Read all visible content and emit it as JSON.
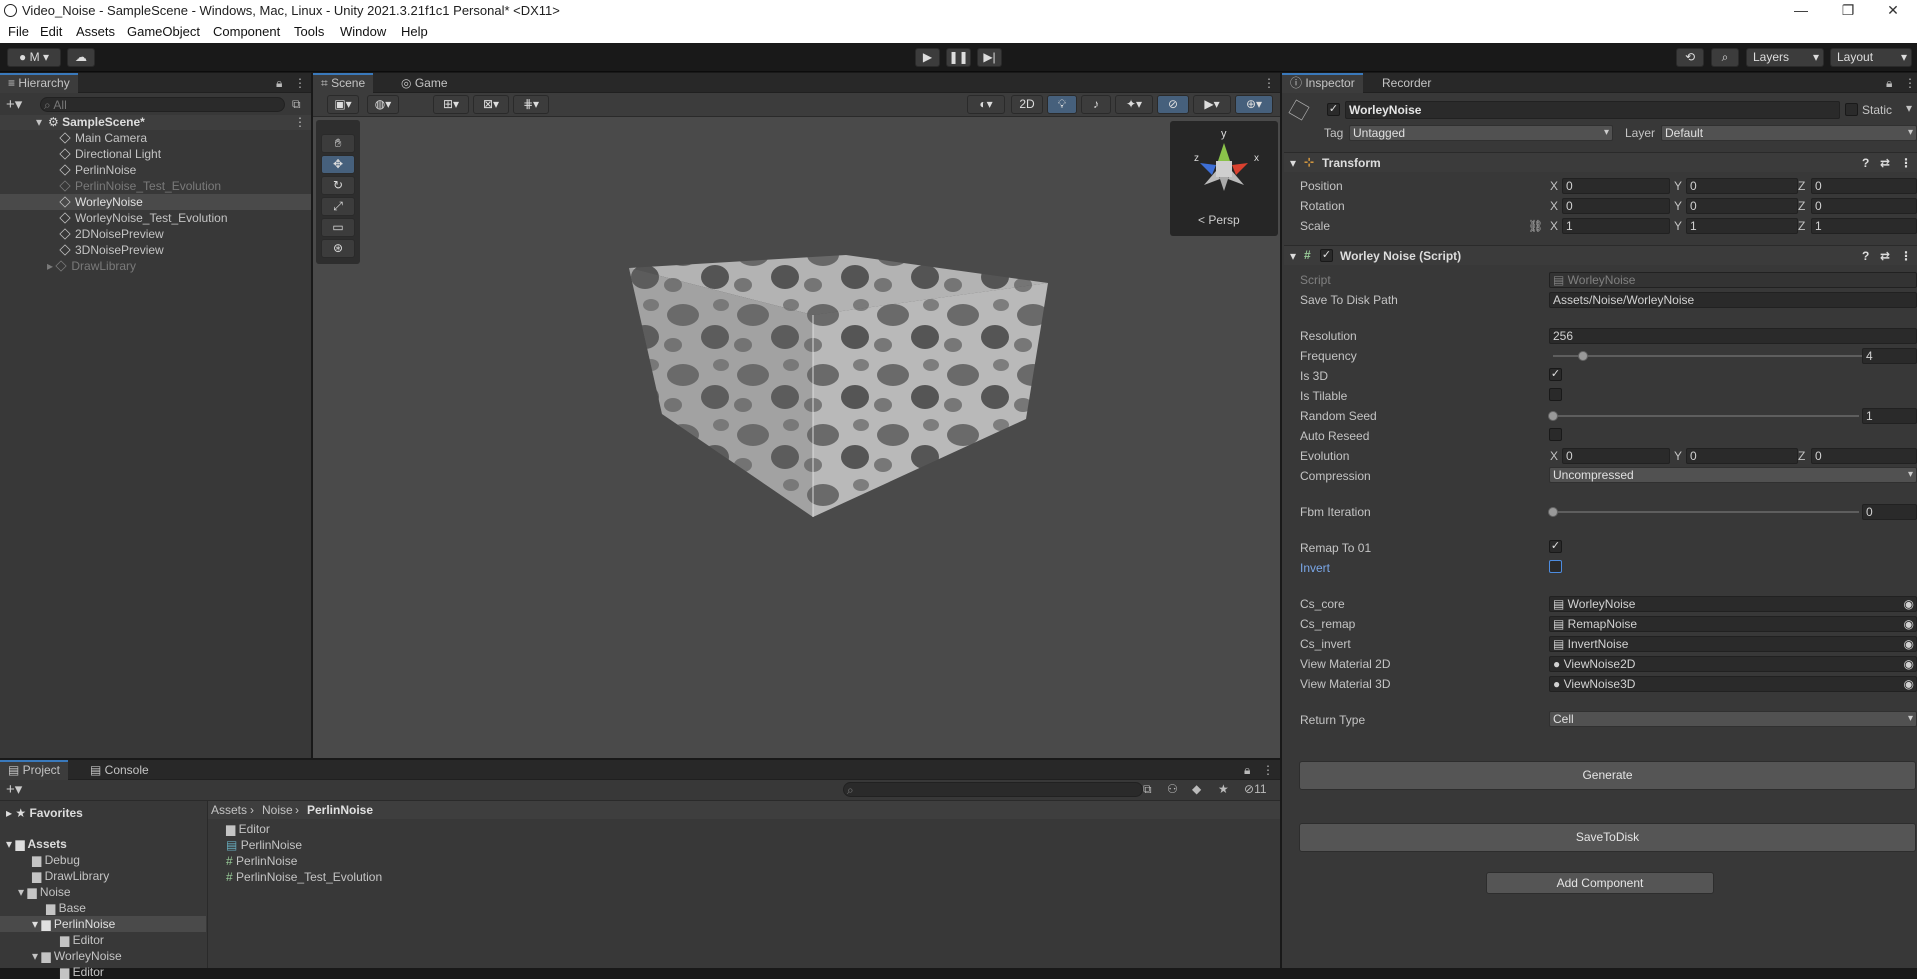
{
  "window": {
    "title": "Video_Noise - SampleScene - Windows, Mac, Linux - Unity 2021.3.21f1c1 Personal* <DX11>"
  },
  "menu": [
    "File",
    "Edit",
    "Assets",
    "GameObject",
    "Component",
    "Tools",
    "Window",
    "Help"
  ],
  "toolbar": {
    "account": "M",
    "layers": "Layers",
    "layout": "Layout"
  },
  "hierarchy": {
    "tab": "Hierarchy",
    "search_placeholder": "All",
    "scene": "SampleScene*",
    "items": [
      "Main Camera",
      "Directional Light",
      "PerlinNoise",
      "PerlinNoise_Test_Evolution",
      "WorleyNoise",
      "WorleyNoise_Test_Evolution",
      "2DNoisePreview",
      "3DNoisePreview",
      "DrawLibrary"
    ]
  },
  "scene": {
    "tab_scene": "Scene",
    "tab_game": "Game",
    "mode_2d": "2D",
    "persp": "Persp",
    "gizmo_y": "y",
    "gizmo_x": "x",
    "gizmo_z": "z"
  },
  "inspector": {
    "tab": "Inspector",
    "tab2": "Recorder",
    "object_name": "WorleyNoise",
    "static_label": "Static",
    "tag_label": "Tag",
    "tag_value": "Untagged",
    "layer_label": "Layer",
    "layer_value": "Default",
    "transform": {
      "title": "Transform",
      "position_label": "Position",
      "rotation_label": "Rotation",
      "scale_label": "Scale",
      "position": [
        "0",
        "0",
        "0"
      ],
      "rotation": [
        "0",
        "0",
        "0"
      ],
      "scale": [
        "1",
        "1",
        "1"
      ]
    },
    "script": {
      "title": "Worley Noise (Script)",
      "script_label": "Script",
      "script_value": "WorleyNoise",
      "save_path_label": "Save To Disk Path",
      "save_path_value": "Assets/Noise/WorleyNoise",
      "resolution_label": "Resolution",
      "resolution_value": "256",
      "frequency_label": "Frequency",
      "frequency_value": "4",
      "is3d_label": "Is 3D",
      "tilable_label": "Is Tilable",
      "seed_label": "Random Seed",
      "seed_value": "1",
      "reseed_label": "Auto Reseed",
      "evolution_label": "Evolution",
      "evolution": [
        "0",
        "0",
        "0"
      ],
      "compression_label": "Compression",
      "compression_value": "Uncompressed",
      "fbm_label": "Fbm Iteration",
      "fbm_value": "0",
      "remap_label": "Remap To 01",
      "invert_label": "Invert",
      "cs_core_label": "Cs_core",
      "cs_core_value": "WorleyNoise",
      "cs_remap_label": "Cs_remap",
      "cs_remap_value": "RemapNoise",
      "cs_invert_label": "Cs_invert",
      "cs_invert_value": "InvertNoise",
      "vm2d_label": "View Material 2D",
      "vm2d_value": "ViewNoise2D",
      "vm3d_label": "View Material 3D",
      "vm3d_value": "ViewNoise3D",
      "return_label": "Return Type",
      "return_value": "Cell",
      "generate": "Generate",
      "save": "SaveToDisk"
    },
    "add_component": "Add Component"
  },
  "project": {
    "tab": "Project",
    "tab2": "Console",
    "favorites": "Favorites",
    "assets": "Assets",
    "tree": [
      "Debug",
      "DrawLibrary",
      "Noise",
      "Base",
      "PerlinNoise",
      "Editor",
      "WorleyNoise",
      "Editor"
    ],
    "breadcrumb": [
      "Assets",
      "Noise",
      "PerlinNoise"
    ],
    "files": [
      "Editor",
      "PerlinNoise",
      "PerlinNoise",
      "PerlinNoise_Test_Evolution"
    ],
    "hidden_count": "11"
  },
  "colors": {
    "accent": "#3a79bb",
    "panel": "#383838",
    "toolbar": "#191919"
  }
}
